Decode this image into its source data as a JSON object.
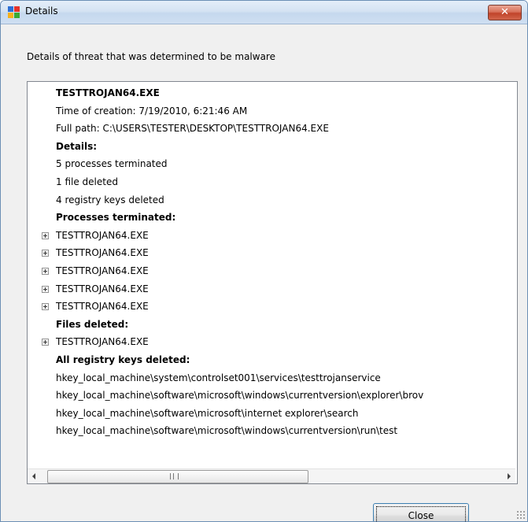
{
  "window": {
    "title": "Details",
    "close_glyph": "✕",
    "app_icon": "avg-logo-icon"
  },
  "description": "Details of threat that was determined to be malware",
  "tree": {
    "rows": [
      {
        "text": "TESTTROJAN64.EXE",
        "bold": true,
        "expandable": false
      },
      {
        "text": "Time of creation: 7/19/2010, 6:21:46 AM",
        "bold": false,
        "expandable": false
      },
      {
        "text": "Full path: C:\\USERS\\TESTER\\DESKTOP\\TESTTROJAN64.EXE",
        "bold": false,
        "expandable": false
      },
      {
        "text": "Details:",
        "bold": true,
        "expandable": false
      },
      {
        "text": "5 processes terminated",
        "bold": false,
        "expandable": false
      },
      {
        "text": "1 file deleted",
        "bold": false,
        "expandable": false
      },
      {
        "text": "4 registry keys deleted",
        "bold": false,
        "expandable": false
      },
      {
        "text": "Processes terminated:",
        "bold": true,
        "expandable": false
      },
      {
        "text": "TESTTROJAN64.EXE",
        "bold": false,
        "expandable": true
      },
      {
        "text": "TESTTROJAN64.EXE",
        "bold": false,
        "expandable": true
      },
      {
        "text": "TESTTROJAN64.EXE",
        "bold": false,
        "expandable": true
      },
      {
        "text": "TESTTROJAN64.EXE",
        "bold": false,
        "expandable": true
      },
      {
        "text": "TESTTROJAN64.EXE",
        "bold": false,
        "expandable": true
      },
      {
        "text": "Files deleted:",
        "bold": true,
        "expandable": false
      },
      {
        "text": "TESTTROJAN64.EXE",
        "bold": false,
        "expandable": true
      },
      {
        "text": "All registry keys deleted:",
        "bold": true,
        "expandable": false
      },
      {
        "text": "hkey_local_machine\\system\\controlset001\\services\\testtrojanservice",
        "bold": false,
        "expandable": false
      },
      {
        "text": "hkey_local_machine\\software\\microsoft\\windows\\currentversion\\explorer\\brov",
        "bold": false,
        "expandable": false
      },
      {
        "text": "hkey_local_machine\\software\\microsoft\\internet explorer\\search",
        "bold": false,
        "expandable": false
      },
      {
        "text": "hkey_local_machine\\software\\microsoft\\windows\\currentversion\\run\\test",
        "bold": false,
        "expandable": false
      }
    ]
  },
  "scrollbar": {
    "grip_label": "III"
  },
  "buttons": {
    "close_label": "Close"
  },
  "colors": {
    "title_close": "#c1442a",
    "focus_border": "#3c7fb1"
  }
}
